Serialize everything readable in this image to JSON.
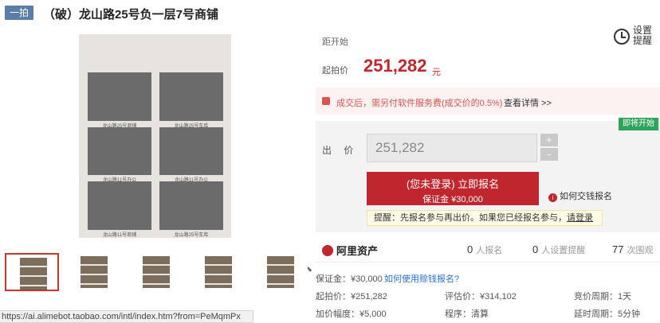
{
  "header": {
    "tag": "一拍",
    "title": "（破）龙山路25号负一层7号商铺"
  },
  "gallery": {
    "captions": [
      "龙山路25号商铺",
      "龙山路25号车库",
      "龙山路11号办公",
      "龙山路11号办公",
      "龙山路11号商铺",
      "龙山路25号车库"
    ],
    "thumb_count": 5
  },
  "status_bar": {
    "url": "https://ai.alimebot.taobao.com/intl/index.htm?from=PeMqmPx"
  },
  "auction": {
    "countdown_label": "距开始",
    "remind_label": "设置提醒",
    "start_price_label": "起拍价",
    "start_price": "251,282",
    "start_price_unit": "元",
    "fee_notice": "成交后，需另付软件服务费(成交价的0.5%)",
    "fee_link": "查看详情 >>",
    "instant_badge": "即将开始",
    "bid_label": "出 价",
    "bid_value": "251,282",
    "plus": "+",
    "minus": "-",
    "signup_line1": "(您未登录) 立即报名",
    "signup_line2": "保证金 ¥30,000",
    "help_icon": "i",
    "help_text": "如何交钱报名",
    "tip": "提醒：先报名参与再出价。如果您已经报名参与，",
    "tip_link": "请登录"
  },
  "stats": {
    "brand": "阿里资产",
    "registrants_n": "0",
    "registrants_label": "人报名",
    "reminders_n": "0",
    "reminders_label": "人设置提醒",
    "views_n": "77",
    "views_label": "次围观"
  },
  "details": {
    "deposit": "保证金：¥30,000",
    "deposit_link": "如何使用赊钱报名?",
    "start_price": "起拍价：¥251,282",
    "appraisal": "评估价：¥314,102",
    "period": "竞价周期：1天",
    "increment": "加价幅度：¥5,000",
    "procedure": "程序：清算",
    "extension": "延时周期：5分钟"
  },
  "colors": {
    "accent": "#c0262d",
    "tag": "#5b7ea8",
    "badge": "#2fa55b"
  }
}
